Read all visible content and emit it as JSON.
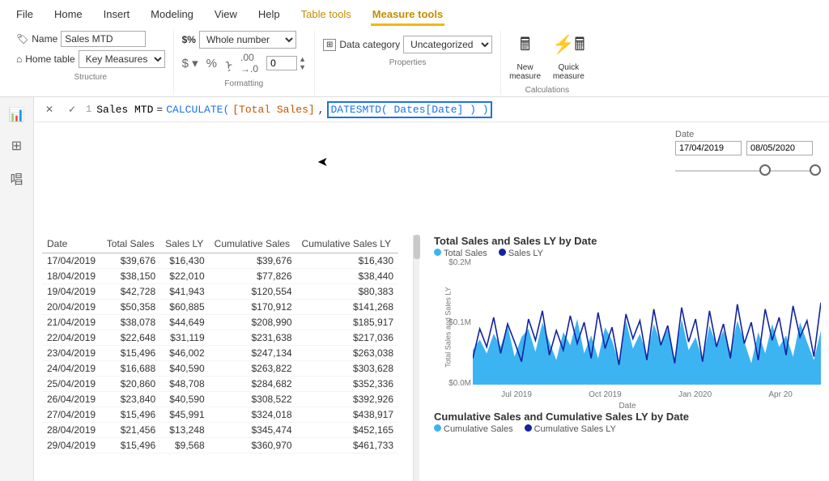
{
  "ribbon": {
    "tabs": [
      "File",
      "Home",
      "Insert",
      "Modeling",
      "View",
      "Help",
      "Table tools",
      "Measure tools"
    ],
    "name_label": "Name",
    "name_value": "Sales MTD",
    "home_table_label": "Home table",
    "home_table_value": "Key Measures",
    "format_value": "Whole number",
    "decimals_value": "0",
    "data_category_label": "Data category",
    "data_category_value": "Uncategorized",
    "group_structure": "Structure",
    "group_formatting": "Formatting",
    "group_properties": "Properties",
    "group_calculations": "Calculations",
    "new_measure": "New\nmeasure",
    "quick_measure": "Quick\nmeasure"
  },
  "formula": {
    "line": "1",
    "name": "Sales MTD",
    "eq": "=",
    "fn": "CALCULATE(",
    "arg1": "[Total Sales]",
    "comma": ",",
    "highlighted": "DATESMTD( Dates[Date] ) )"
  },
  "slicer": {
    "label": "Date",
    "from": "17/04/2019",
    "to": "08/05/2020"
  },
  "table": {
    "headers": [
      "Date",
      "Total Sales",
      "Sales LY",
      "Cumulative Sales",
      "Cumulative Sales LY"
    ],
    "rows": [
      [
        "17/04/2019",
        "$39,676",
        "$16,430",
        "$39,676",
        "$16,430"
      ],
      [
        "18/04/2019",
        "$38,150",
        "$22,010",
        "$77,826",
        "$38,440"
      ],
      [
        "19/04/2019",
        "$42,728",
        "$41,943",
        "$120,554",
        "$80,383"
      ],
      [
        "20/04/2019",
        "$50,358",
        "$60,885",
        "$170,912",
        "$141,268"
      ],
      [
        "21/04/2019",
        "$38,078",
        "$44,649",
        "$208,990",
        "$185,917"
      ],
      [
        "22/04/2019",
        "$22,648",
        "$31,119",
        "$231,638",
        "$217,036"
      ],
      [
        "23/04/2019",
        "$15,496",
        "$46,002",
        "$247,134",
        "$263,038"
      ],
      [
        "24/04/2019",
        "$16,688",
        "$40,590",
        "$263,822",
        "$303,628"
      ],
      [
        "25/04/2019",
        "$20,860",
        "$48,708",
        "$284,682",
        "$352,336"
      ],
      [
        "26/04/2019",
        "$23,840",
        "$40,590",
        "$308,522",
        "$392,926"
      ],
      [
        "27/04/2019",
        "$15,496",
        "$45,991",
        "$324,018",
        "$438,917"
      ],
      [
        "28/04/2019",
        "$21,456",
        "$13,248",
        "$345,474",
        "$452,165"
      ],
      [
        "29/04/2019",
        "$15,496",
        "$9,568",
        "$360,970",
        "$461,733"
      ]
    ]
  },
  "chart1": {
    "title": "Total Sales and Sales LY by Date",
    "legend_a": "Total Sales",
    "legend_b": "Sales LY",
    "ylabel": "Total Sales and Sales LY",
    "xlabel": "Date",
    "yticks": [
      "$0.2M",
      "$0.1M",
      "$0.0M"
    ],
    "xticks": [
      "Jul 2019",
      "Oct 2019",
      "Jan 2020",
      "Apr 20"
    ]
  },
  "chart2": {
    "title": "Cumulative Sales and Cumulative Sales LY by Date",
    "legend_a": "Cumulative Sales",
    "legend_b": "Cumulative Sales LY"
  },
  "colors": {
    "series_a": "#3db4f2",
    "series_b": "#12239e"
  },
  "chart_data": [
    {
      "type": "area",
      "title": "Total Sales and Sales LY by Date",
      "xlabel": "Date",
      "ylabel": "Total Sales and Sales LY",
      "ylim": [
        0,
        200000
      ],
      "series": [
        {
          "name": "Total Sales",
          "color": "#3db4f2"
        },
        {
          "name": "Sales LY",
          "color": "#12239e"
        }
      ],
      "x_ticks": [
        "Jul 2019",
        "Oct 2019",
        "Jan 2020",
        "Apr 2020"
      ],
      "y_ticks": [
        0,
        100000,
        200000
      ],
      "note": "daily values roughly 15k–60k per series over 17/04/2019–08/05/2020; exact per-day values shown in adjacent table"
    },
    {
      "type": "area",
      "title": "Cumulative Sales and Cumulative Sales LY by Date",
      "series": [
        {
          "name": "Cumulative Sales",
          "color": "#3db4f2"
        },
        {
          "name": "Cumulative Sales LY",
          "color": "#12239e"
        }
      ],
      "note": "running totals of the two series above; only title and legend visible in viewport"
    }
  ]
}
